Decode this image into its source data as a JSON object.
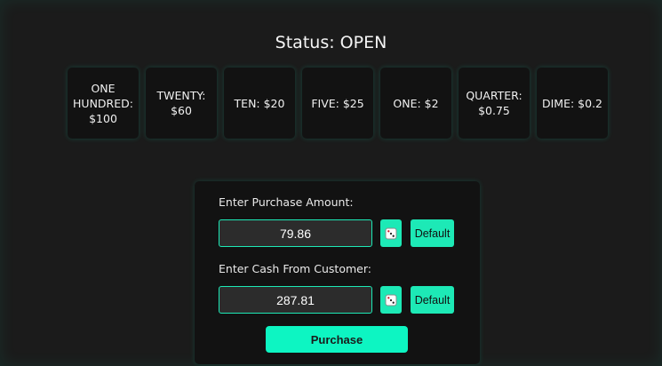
{
  "status": {
    "label": "Status:",
    "value": "OPEN"
  },
  "drawer": [
    {
      "text": "ONE HUNDRED: $100"
    },
    {
      "text": "TWENTY: $60"
    },
    {
      "text": "TEN: $20"
    },
    {
      "text": "FIVE: $25"
    },
    {
      "text": "ONE: $2"
    },
    {
      "text": "QUARTER: $0.75"
    },
    {
      "text": "DIME: $0.2"
    }
  ],
  "form": {
    "purchase_label": "Enter Purchase Amount:",
    "purchase_value": "79.86",
    "cash_label": "Enter Cash From Customer:",
    "cash_value": "287.81",
    "random_icon": "dice-icon",
    "default_label": "Default",
    "purchase_button": "Purchase"
  },
  "colors": {
    "accent": "#1de9b6",
    "background": "#1b1b1b",
    "panel": "#121212"
  }
}
